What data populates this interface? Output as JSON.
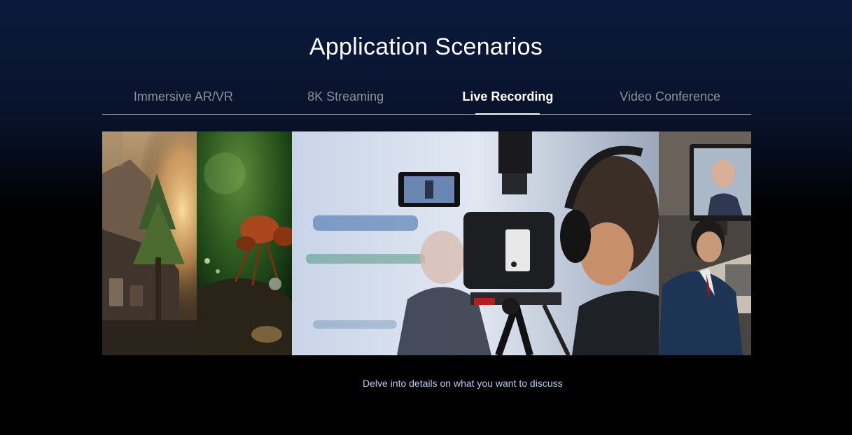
{
  "page": {
    "title": "Application Scenarios",
    "caption": "Delve into details on what you want to discuss"
  },
  "tabs": [
    {
      "label": "Immersive AR/VR",
      "active": false
    },
    {
      "label": "8K Streaming",
      "active": false
    },
    {
      "label": "Live Recording",
      "active": true
    },
    {
      "label": "Video Conference",
      "active": false
    }
  ],
  "gallery": {
    "panels": [
      {
        "scene": "sunlit-house-forest"
      },
      {
        "scene": "ant-macro"
      },
      {
        "scene": "camera-operator-recording",
        "active": true
      },
      {
        "scene": "video-conference-office"
      }
    ]
  },
  "colors": {
    "background_top": "#0a1a3b",
    "tab_inactive": "#8c919b",
    "tab_active": "#ffffff",
    "caption": "#b9c9f2"
  }
}
